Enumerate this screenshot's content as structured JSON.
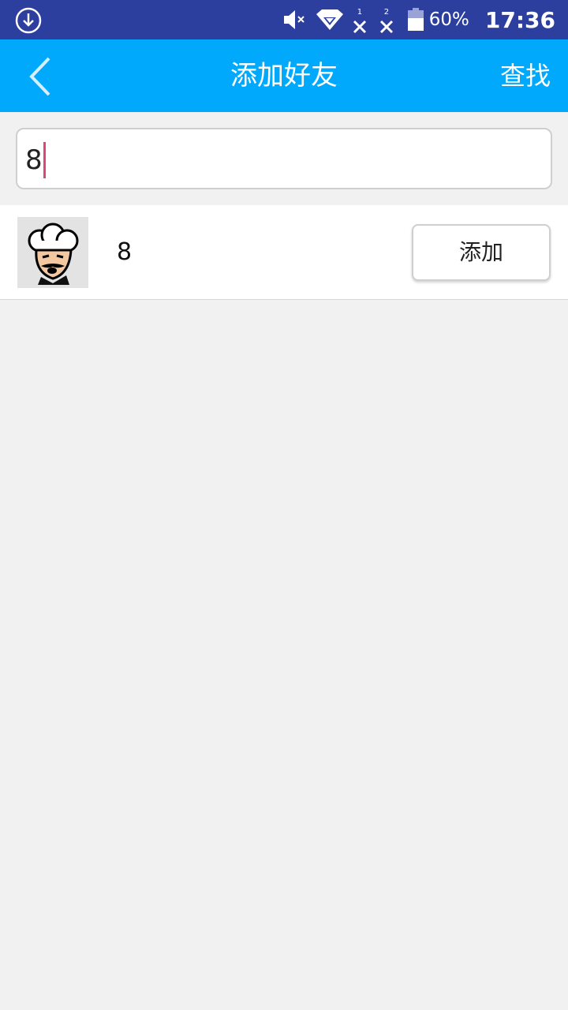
{
  "status_bar": {
    "battery_percent": "60%",
    "time": "17:36",
    "sim1_label": "1",
    "sim2_label": "2",
    "icons": [
      "download-icon",
      "mute-icon",
      "wifi-icon",
      "sim1-no-signal-icon",
      "sim2-no-signal-icon",
      "battery-icon"
    ]
  },
  "app_bar": {
    "title": "添加好友",
    "action_label": "查找",
    "back_icon": "chevron-left-icon",
    "background": "#00a9fc"
  },
  "search": {
    "value": "8"
  },
  "results": [
    {
      "name": "8",
      "avatar_icon": "chef-avatar",
      "button_label": "添加"
    }
  ],
  "colors": {
    "status_bar": "#2c3e9e",
    "app_bar": "#00a9fc",
    "page_bg": "#f1f1f1",
    "caret": "#e0457a"
  }
}
